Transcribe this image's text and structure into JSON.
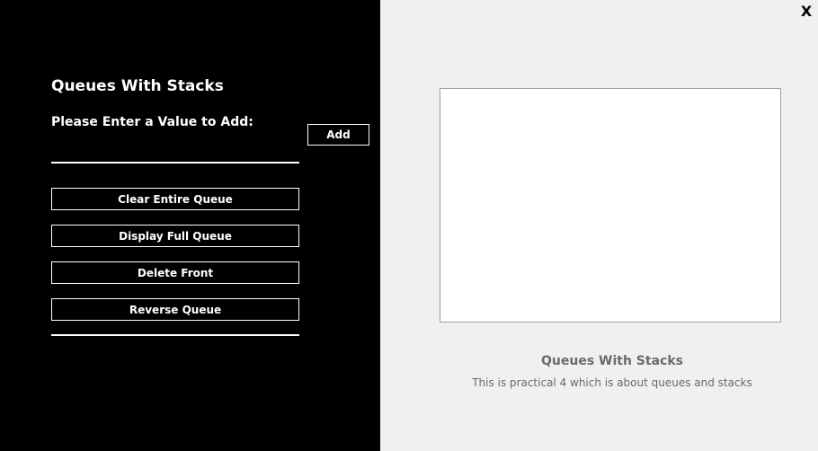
{
  "window": {
    "close_label": "X"
  },
  "left_panel": {
    "title": "Queues With Stacks",
    "prompt": "Please Enter a Value to Add:",
    "add_button_label": "Add",
    "value_input": {
      "value": "",
      "placeholder": ""
    },
    "actions": [
      {
        "label": "Clear Entire Queue"
      },
      {
        "label": "Display Full Queue"
      },
      {
        "label": "Delete Front"
      },
      {
        "label": "Reverse Queue"
      }
    ]
  },
  "right_panel": {
    "output_text": "",
    "info_title": "Queues With Stacks",
    "info_description": "This is practical 4 which is about queues and stacks"
  },
  "colors": {
    "left_background": "#000000",
    "right_background": "#f0f0f0",
    "foreground_light": "#ffffff",
    "muted_text": "#6a6a6a"
  }
}
